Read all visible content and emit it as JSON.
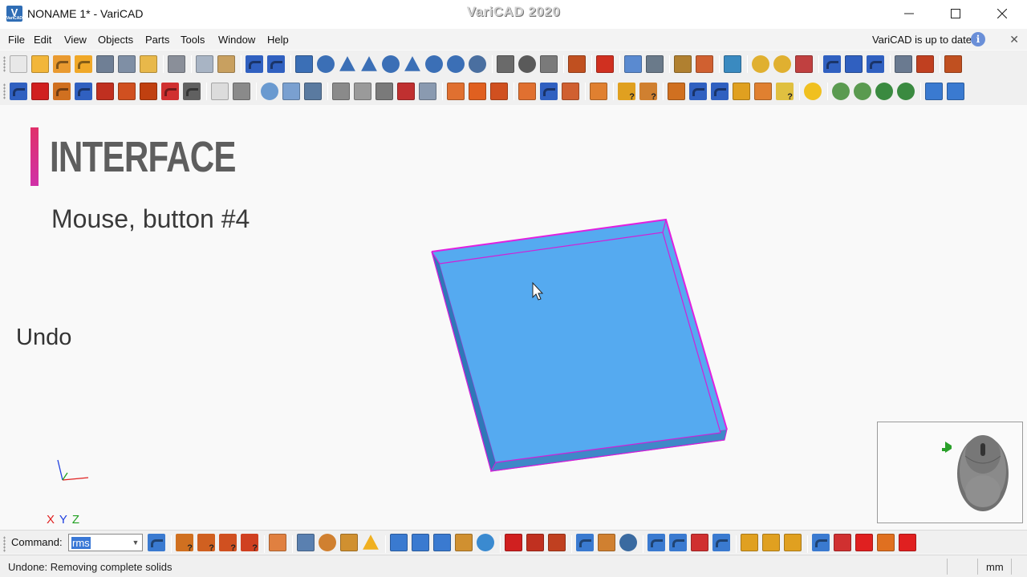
{
  "window": {
    "title": "NONAME 1* - VariCAD",
    "brand": "VariCAD 2020",
    "logo_text": "V",
    "logo_sub": "VariCAD"
  },
  "menu": {
    "items": [
      "File",
      "Edit",
      "View",
      "Objects",
      "Parts",
      "Tools",
      "Window",
      "Help"
    ],
    "update_status": "VariCAD is up to date",
    "info_glyph": "i",
    "close_glyph": "✕"
  },
  "canvas": {
    "heading": "INTERFACE",
    "subheading": "Mouse, button #4",
    "action": "Undo",
    "axes": {
      "x": "X",
      "y": "Y",
      "z": "Z"
    },
    "colors": {
      "solid": "#55aaf0",
      "edge": "#e020e0",
      "accent": "#e0306a"
    }
  },
  "command": {
    "label": "Command:",
    "value": "rms",
    "dropdown_glyph": "▼"
  },
  "status": {
    "message": "Undone: Removing complete solids",
    "unit": "mm"
  },
  "toolbars": {
    "row1": [
      {
        "name": "new-file-icon",
        "color": "#e8e8e8",
        "shape": "box"
      },
      {
        "name": "open-file-icon",
        "color": "#f2b63a",
        "shape": "box"
      },
      {
        "name": "open-recent-icon",
        "color": "#e99a30",
        "shape": "arrow"
      },
      {
        "name": "export-icon",
        "color": "#f0a828",
        "shape": "arrow"
      },
      {
        "name": "save-icon",
        "color": "#6f7f95",
        "shape": "box"
      },
      {
        "name": "save-all-icon",
        "color": "#7f8fa5",
        "shape": "box"
      },
      {
        "name": "save-check-icon",
        "color": "#e8b84a",
        "shape": "box"
      },
      {
        "name": "sep",
        "color": "",
        "shape": "sep"
      },
      {
        "name": "print-icon",
        "color": "#8a8f99",
        "shape": "box"
      },
      {
        "name": "sep",
        "color": "",
        "shape": "sep"
      },
      {
        "name": "copy-icon",
        "color": "#a8b4c4",
        "shape": "box"
      },
      {
        "name": "paste-icon",
        "color": "#c8a060",
        "shape": "box"
      },
      {
        "name": "sep",
        "color": "",
        "shape": "sep"
      },
      {
        "name": "undo-icon",
        "color": "#3060c0",
        "shape": "arrow"
      },
      {
        "name": "redo-icon",
        "color": "#3060c0",
        "shape": "arrow"
      },
      {
        "name": "sep",
        "color": "",
        "shape": "sep"
      },
      {
        "name": "box-solid-icon",
        "color": "#3b6fb6",
        "shape": "box"
      },
      {
        "name": "cylinder-icon",
        "color": "#3b6fb6",
        "shape": "circle"
      },
      {
        "name": "wedge-icon",
        "color": "#3b6fb6",
        "shape": "tri"
      },
      {
        "name": "cone-icon",
        "color": "#3b6fb6",
        "shape": "tri"
      },
      {
        "name": "torus-icon",
        "color": "#3b6fb6",
        "shape": "circle"
      },
      {
        "name": "pyramid-icon",
        "color": "#3b6fb6",
        "shape": "tri"
      },
      {
        "name": "revolve-icon",
        "color": "#3b6fb6",
        "shape": "circle"
      },
      {
        "name": "pipe-icon",
        "color": "#3b6fb6",
        "shape": "circle"
      },
      {
        "name": "sphere-icon",
        "color": "#4a6fa0",
        "shape": "circle"
      },
      {
        "name": "sep",
        "color": "",
        "shape": "sep"
      },
      {
        "name": "bolt-icon",
        "color": "#6a6a6a",
        "shape": "box"
      },
      {
        "name": "gear-icon",
        "color": "#5a5a5a",
        "shape": "circle"
      },
      {
        "name": "spring-icon",
        "color": "#7a7a7a",
        "shape": "box"
      },
      {
        "name": "sep",
        "color": "",
        "shape": "sep"
      },
      {
        "name": "insert-part-icon",
        "color": "#c05020",
        "shape": "box"
      },
      {
        "name": "sep",
        "color": "",
        "shape": "sep"
      },
      {
        "name": "measure-icon",
        "color": "#d03020",
        "shape": "box"
      },
      {
        "name": "sep",
        "color": "",
        "shape": "sep"
      },
      {
        "name": "section-icon",
        "color": "#5a8ad0",
        "shape": "box"
      },
      {
        "name": "view-section-icon",
        "color": "#6a7a8a",
        "shape": "box"
      },
      {
        "name": "sep",
        "color": "",
        "shape": "sep"
      },
      {
        "name": "sheet-metal-icon",
        "color": "#b08030",
        "shape": "box"
      },
      {
        "name": "unfold-icon",
        "color": "#d06030",
        "shape": "box"
      },
      {
        "name": "sep",
        "color": "",
        "shape": "sep"
      },
      {
        "name": "monitor-icon",
        "color": "#3a8ac0",
        "shape": "box"
      },
      {
        "name": "sep",
        "color": "",
        "shape": "sep"
      },
      {
        "name": "zoom-previous-icon",
        "color": "#e0b030",
        "shape": "circle"
      },
      {
        "name": "zoom-all-icon",
        "color": "#e0b030",
        "shape": "circle"
      },
      {
        "name": "render-mode-icon",
        "color": "#c04040",
        "shape": "box"
      },
      {
        "name": "sep",
        "color": "",
        "shape": "sep"
      },
      {
        "name": "axes-icon",
        "color": "#3060c0",
        "shape": "arrow"
      },
      {
        "name": "frame-icon",
        "color": "#3060c0",
        "shape": "box"
      },
      {
        "name": "transform-icon",
        "color": "#3060c0",
        "shape": "arrow"
      },
      {
        "name": "sep",
        "color": "",
        "shape": "sep"
      },
      {
        "name": "view-cube-icon",
        "color": "#6a7a90",
        "shape": "box"
      },
      {
        "name": "switch-view-icon",
        "color": "#c04020",
        "shape": "box"
      },
      {
        "name": "sep",
        "color": "",
        "shape": "sep"
      },
      {
        "name": "export-view-icon",
        "color": "#c05020",
        "shape": "box"
      }
    ],
    "row2": [
      {
        "name": "select-arrows-icon",
        "color": "#3060c0",
        "shape": "arrow"
      },
      {
        "name": "delete-icon",
        "color": "#d02020",
        "shape": "box"
      },
      {
        "name": "move-icon",
        "color": "#d07020",
        "shape": "arrow"
      },
      {
        "name": "copy-move-icon",
        "color": "#3060c0",
        "shape": "arrow"
      },
      {
        "name": "align-icon",
        "color": "#c03020",
        "shape": "box"
      },
      {
        "name": "attach-icon",
        "color": "#d05020",
        "shape": "box"
      },
      {
        "name": "anchor-icon",
        "color": "#c04010",
        "shape": "box"
      },
      {
        "name": "rotate-icon",
        "color": "#d03030",
        "shape": "arrow"
      },
      {
        "name": "transform-multi-icon",
        "color": "#606060",
        "shape": "arrow"
      },
      {
        "name": "sep",
        "color": "",
        "shape": "sep"
      },
      {
        "name": "transparent-box-icon",
        "color": "#dcdcdc",
        "shape": "box"
      },
      {
        "name": "wireframe-box-icon",
        "color": "#8a8a8a",
        "shape": "box"
      },
      {
        "name": "sep",
        "color": "",
        "shape": "sep"
      },
      {
        "name": "color-icon",
        "color": "#6a9ad0",
        "shape": "circle"
      },
      {
        "name": "texture-icon",
        "color": "#7aa0d0",
        "shape": "box"
      },
      {
        "name": "solid-box-icon",
        "color": "#5a7aa0",
        "shape": "box"
      },
      {
        "name": "sep",
        "color": "",
        "shape": "sep"
      },
      {
        "name": "thread-icon",
        "color": "#8a8a8a",
        "shape": "box"
      },
      {
        "name": "ribs-icon",
        "color": "#9a9a9a",
        "shape": "box"
      },
      {
        "name": "fillet-icon",
        "color": "#7a7a7a",
        "shape": "box"
      },
      {
        "name": "shell-icon",
        "color": "#c03030",
        "shape": "box"
      },
      {
        "name": "chamfer-icon",
        "color": "#8a9ab0",
        "shape": "box"
      },
      {
        "name": "sep",
        "color": "",
        "shape": "sep"
      },
      {
        "name": "boolean-add-icon",
        "color": "#e07030",
        "shape": "box"
      },
      {
        "name": "boolean-cut-icon",
        "color": "#e06020",
        "shape": "box"
      },
      {
        "name": "boolean-intersect-icon",
        "color": "#d05020",
        "shape": "box"
      },
      {
        "name": "sep",
        "color": "",
        "shape": "sep"
      },
      {
        "name": "merge-icon",
        "color": "#e07030",
        "shape": "box"
      },
      {
        "name": "split-icon",
        "color": "#3060c0",
        "shape": "arrow"
      },
      {
        "name": "detach-icon",
        "color": "#d06030",
        "shape": "box"
      },
      {
        "name": "sep",
        "color": "",
        "shape": "sep"
      },
      {
        "name": "overlap-icon",
        "color": "#e08030",
        "shape": "box"
      },
      {
        "name": "sep",
        "color": "",
        "shape": "sep"
      },
      {
        "name": "check-query-icon",
        "color": "#e0a020",
        "shape": "q"
      },
      {
        "name": "info-query-icon",
        "color": "#d08030",
        "shape": "q"
      },
      {
        "name": "sep",
        "color": "",
        "shape": "sep"
      },
      {
        "name": "cut-solid-icon",
        "color": "#d07020",
        "shape": "box"
      },
      {
        "name": "snap-icon",
        "color": "#3060c0",
        "shape": "arrow"
      },
      {
        "name": "dimension-icon",
        "color": "#3060c0",
        "shape": "arrow"
      },
      {
        "name": "edit-dimension-icon",
        "color": "#e0a020",
        "shape": "box"
      },
      {
        "name": "constraint-icon",
        "color": "#e08030",
        "shape": "box"
      },
      {
        "name": "query-solid-icon",
        "color": "#e0c040",
        "shape": "q"
      },
      {
        "name": "sep",
        "color": "",
        "shape": "sep"
      },
      {
        "name": "center-of-mass-icon",
        "color": "#f0c020",
        "shape": "circle"
      },
      {
        "name": "sep",
        "color": "",
        "shape": "sep"
      },
      {
        "name": "zoom-window-icon",
        "color": "#5a9a50",
        "shape": "circle"
      },
      {
        "name": "zoom-extent-icon",
        "color": "#5a9a50",
        "shape": "circle"
      },
      {
        "name": "zoom-out-icon",
        "color": "#3a8a40",
        "shape": "circle"
      },
      {
        "name": "zoom-in-icon",
        "color": "#3a8a40",
        "shape": "circle"
      },
      {
        "name": "sep",
        "color": "",
        "shape": "sep"
      },
      {
        "name": "mode-2d-icon",
        "color": "#3a7ad0",
        "shape": "box"
      },
      {
        "name": "mode-3d-icon",
        "color": "#3a7ad0",
        "shape": "box"
      }
    ],
    "cmd": [
      {
        "name": "command-export-icon",
        "color": "#3a7ad0",
        "shape": "arrow"
      },
      {
        "name": "sep",
        "color": "",
        "shape": "sep"
      },
      {
        "name": "query-v-icon",
        "color": "#d07020",
        "shape": "q"
      },
      {
        "name": "query-s-icon",
        "color": "#d06020",
        "shape": "q"
      },
      {
        "name": "query-s2-icon",
        "color": "#d05020",
        "shape": "q"
      },
      {
        "name": "query-j-icon",
        "color": "#d04020",
        "shape": "q"
      },
      {
        "name": "sep",
        "color": "",
        "shape": "sep"
      },
      {
        "name": "eraser-icon",
        "color": "#e08040",
        "shape": "box"
      },
      {
        "name": "sep",
        "color": "",
        "shape": "sep"
      },
      {
        "name": "bucket-icon",
        "color": "#5a80b0",
        "shape": "box"
      },
      {
        "name": "sausage-icon",
        "color": "#d08030",
        "shape": "circle"
      },
      {
        "name": "tube-icon",
        "color": "#d09030",
        "shape": "box"
      },
      {
        "name": "text-icon",
        "color": "#f0b020",
        "shape": "tri"
      },
      {
        "name": "sep",
        "color": "",
        "shape": "sep"
      },
      {
        "name": "layers-icon",
        "color": "#3a7ad0",
        "shape": "box"
      },
      {
        "name": "tree-icon",
        "color": "#3a7ad0",
        "shape": "box"
      },
      {
        "name": "hierarchy-icon",
        "color": "#3a7ad0",
        "shape": "box"
      },
      {
        "name": "group-icon",
        "color": "#d09030",
        "shape": "box"
      },
      {
        "name": "drop-icon",
        "color": "#3a8ad0",
        "shape": "circle"
      },
      {
        "name": "sep",
        "color": "",
        "shape": "sep"
      },
      {
        "name": "bom-icon",
        "color": "#d02020",
        "shape": "box"
      },
      {
        "name": "list-icon",
        "color": "#c03020",
        "shape": "box"
      },
      {
        "name": "table-icon",
        "color": "#c04020",
        "shape": "box"
      },
      {
        "name": "sep",
        "color": "",
        "shape": "sep"
      },
      {
        "name": "open-assembly-icon",
        "color": "#3a7ad0",
        "shape": "arrow"
      },
      {
        "name": "assembly-icon",
        "color": "#d08030",
        "shape": "box"
      },
      {
        "name": "link-icon",
        "color": "#3a6aa0",
        "shape": "circle"
      },
      {
        "name": "sep",
        "color": "",
        "shape": "sep"
      },
      {
        "name": "insert-icon",
        "color": "#3a7ad0",
        "shape": "arrow"
      },
      {
        "name": "update-icon",
        "color": "#3a7ad0",
        "shape": "arrow"
      },
      {
        "name": "remove-link-icon",
        "color": "#d03030",
        "shape": "box"
      },
      {
        "name": "replace-icon",
        "color": "#3a7ad0",
        "shape": "arrow"
      },
      {
        "name": "sep",
        "color": "",
        "shape": "sep"
      },
      {
        "name": "folder-add-icon",
        "color": "#e0a020",
        "shape": "box"
      },
      {
        "name": "folder-update-icon",
        "color": "#e0a020",
        "shape": "box"
      },
      {
        "name": "folder-remove-icon",
        "color": "#e0a020",
        "shape": "box"
      },
      {
        "name": "sep",
        "color": "",
        "shape": "sep"
      },
      {
        "name": "check-icon",
        "color": "#3a7ad0",
        "shape": "arrow"
      },
      {
        "name": "cancel-check-icon",
        "color": "#d03030",
        "shape": "box"
      },
      {
        "name": "cancel-icon",
        "color": "#e02020",
        "shape": "box"
      },
      {
        "name": "cancel-orange-icon",
        "color": "#e07020",
        "shape": "box"
      },
      {
        "name": "close-red-icon",
        "color": "#e02020",
        "shape": "box"
      }
    ]
  }
}
